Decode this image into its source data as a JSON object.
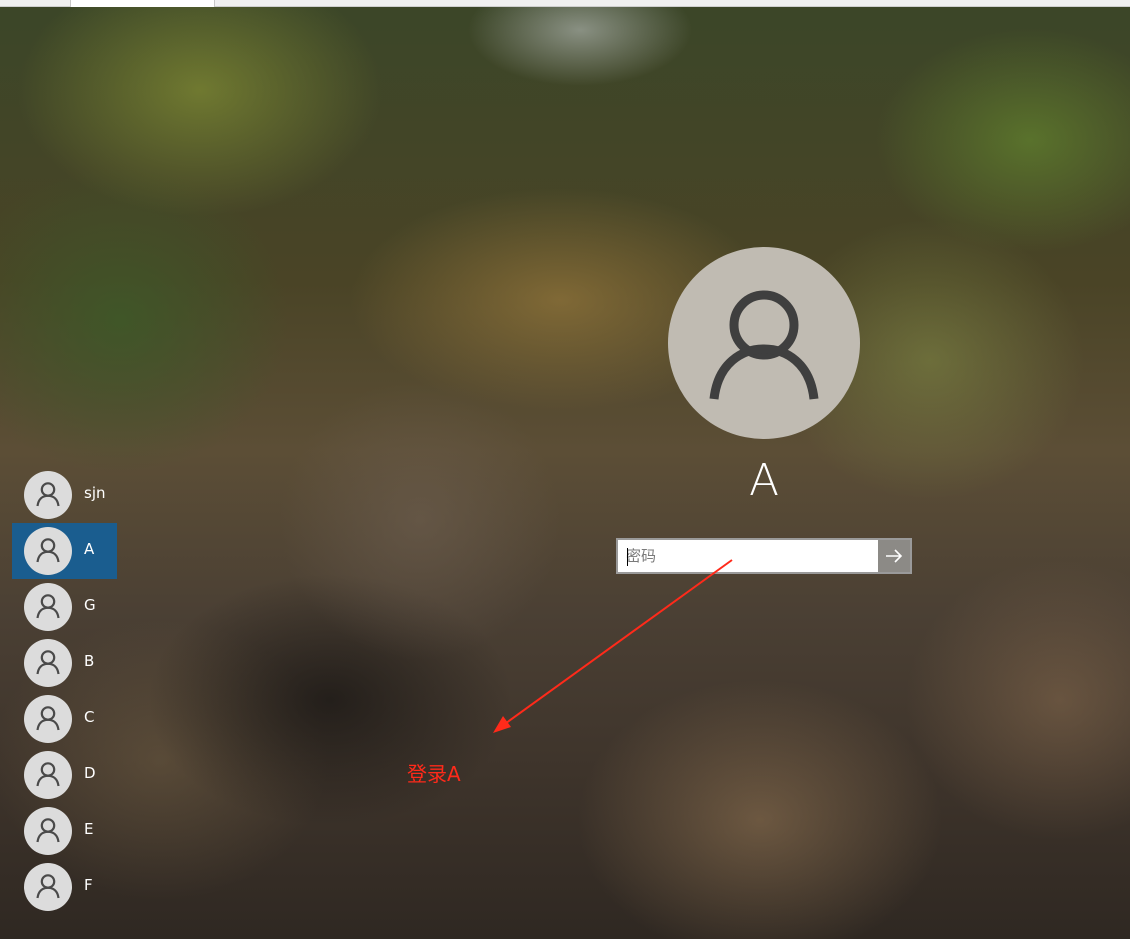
{
  "current_user": {
    "name": "A",
    "avatar_icon": "person-icon"
  },
  "password": {
    "placeholder": "密码",
    "value": "",
    "submit_icon": "arrow-right-icon"
  },
  "users": [
    {
      "name": "sjn",
      "selected": false
    },
    {
      "name": "A",
      "selected": true
    },
    {
      "name": "G",
      "selected": false
    },
    {
      "name": "B",
      "selected": false
    },
    {
      "name": "C",
      "selected": false
    },
    {
      "name": "D",
      "selected": false
    },
    {
      "name": "E",
      "selected": false
    },
    {
      "name": "F",
      "selected": false
    }
  ],
  "annotation": {
    "text": "登录A",
    "color": "#ff2a1a"
  },
  "colors": {
    "selected_user_bg": "#1a5d8f",
    "avatar_bg": "#c0bbb2",
    "small_avatar_bg": "#dcdcdc"
  }
}
